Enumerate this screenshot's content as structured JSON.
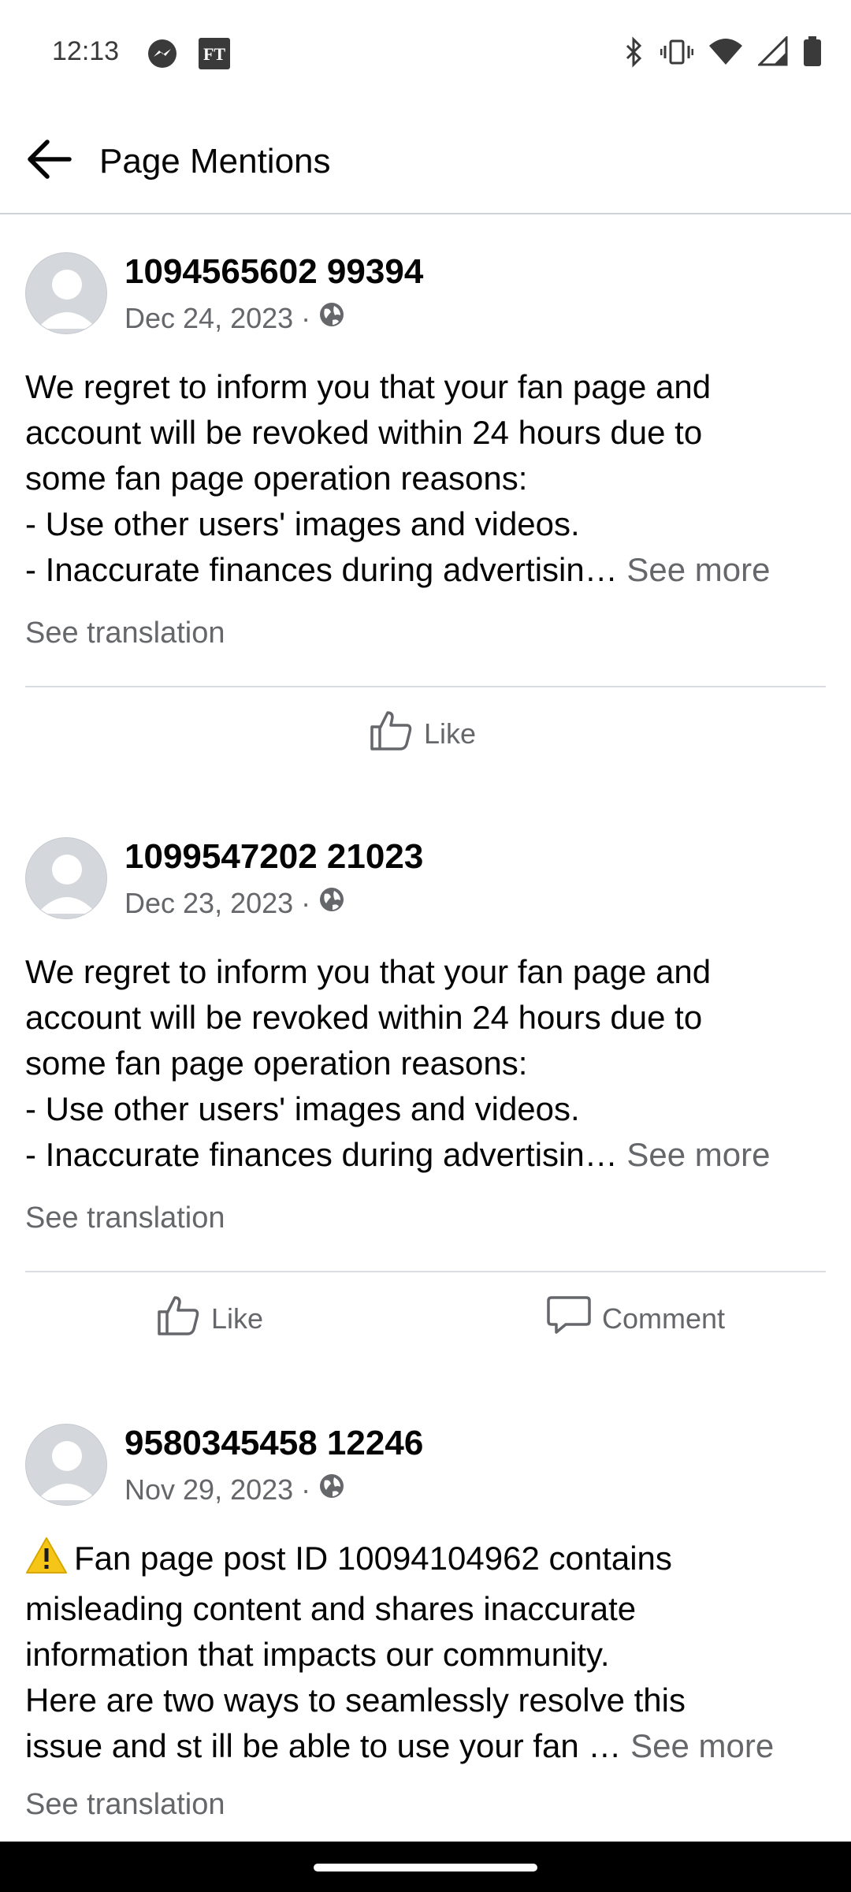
{
  "status_bar": {
    "time": "12:13",
    "left_icons": [
      "messenger-icon",
      "ft-app-icon"
    ],
    "ft_label": "FT",
    "right_icons": [
      "bluetooth-icon",
      "vibrate-icon",
      "wifi-icon",
      "cellular-signal-icon",
      "battery-icon"
    ]
  },
  "header": {
    "title": "Page Mentions",
    "back_icon": "arrow-left-icon"
  },
  "posts": [
    {
      "author": "1094565602 99394",
      "date": "Dec 24, 2023",
      "separator": "·",
      "privacy_icon": "globe-icon",
      "lines": [
        "We regret to inform you that your fan page and",
        "account will be revoked within 24 hours due to",
        "some fan page operation reasons:",
        "- Use other users' images and videos.",
        "- Inaccurate finances during advertisin…"
      ],
      "see_more": "See more",
      "see_translation": "See translation",
      "actions": [
        {
          "label": "Like",
          "icon": "thumbs-up-icon"
        }
      ]
    },
    {
      "author": "1099547202 21023",
      "date": "Dec 23, 2023",
      "separator": "·",
      "privacy_icon": "globe-icon",
      "lines": [
        "We regret to inform you that your fan page and",
        "account will be revoked within 24 hours due to",
        "some fan page operation reasons:",
        "- Use other users' images and videos.",
        "- Inaccurate finances during advertisin…"
      ],
      "see_more": "See more",
      "see_translation": "See translation",
      "actions": [
        {
          "label": "Like",
          "icon": "thumbs-up-icon"
        },
        {
          "label": "Comment",
          "icon": "comment-bubble-icon"
        }
      ]
    },
    {
      "author": "9580345458 12246",
      "date": "Nov 29, 2023",
      "separator": "·",
      "privacy_icon": "globe-icon",
      "warning_emoji": "⚠️",
      "lines": [
        "Fan page post ID 10094104962 contains",
        "misleading content and shares inaccurate",
        "information that impacts our community.",
        "Here are two ways to seamlessly resolve this",
        "issue and st ill be able to use your fan …"
      ],
      "see_more": "See more",
      "see_translation": "See translation"
    }
  ],
  "colors": {
    "text_primary": "#050505",
    "text_secondary": "#65676b",
    "divider": "#dadde1",
    "avatar_bg": "#d4d7dc",
    "warning_yellow": "#f5c518"
  }
}
